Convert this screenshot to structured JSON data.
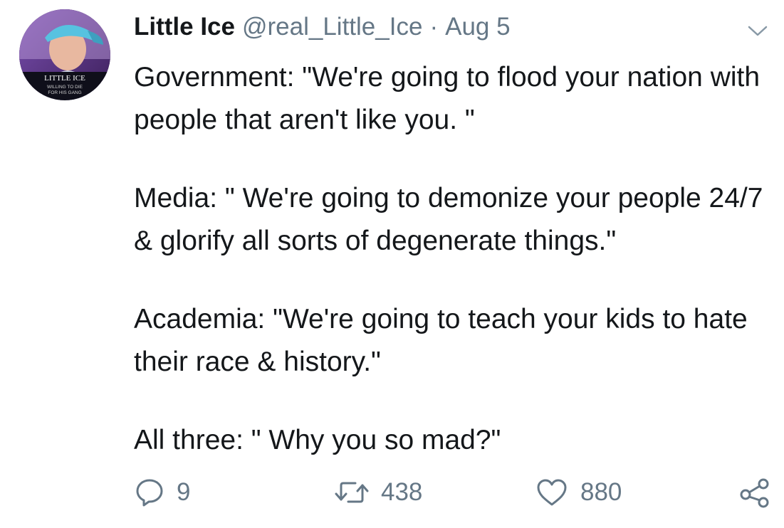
{
  "tweet": {
    "display_name": "Little Ice",
    "handle": "@real_Little_Ice",
    "separator": "·",
    "date": "Aug 5",
    "avatar_text": {
      "line1": "LITTLE ICE",
      "line2": "WILLING TO DIE",
      "line3": "FOR HIS GANG"
    },
    "paragraphs": [
      "Government: \"We're going to flood your nation with people that aren't like you. \"",
      "Media: \" We're going to demonize your people 24/7 & glorify all sorts of degenerate things.\"",
      "Academia: \"We're going to teach your kids to hate their race & history.\"",
      "All three: \" Why you so mad?\""
    ],
    "actions": {
      "replies": "9",
      "retweets": "438",
      "likes": "880"
    },
    "icons": {
      "reply": "speech-bubble-icon",
      "retweet": "retweet-arrows-icon",
      "like": "heart-icon",
      "share": "share-icon",
      "menu": "chevron-down-icon"
    },
    "colors": {
      "text": "#14171a",
      "muted": "#657786"
    }
  }
}
